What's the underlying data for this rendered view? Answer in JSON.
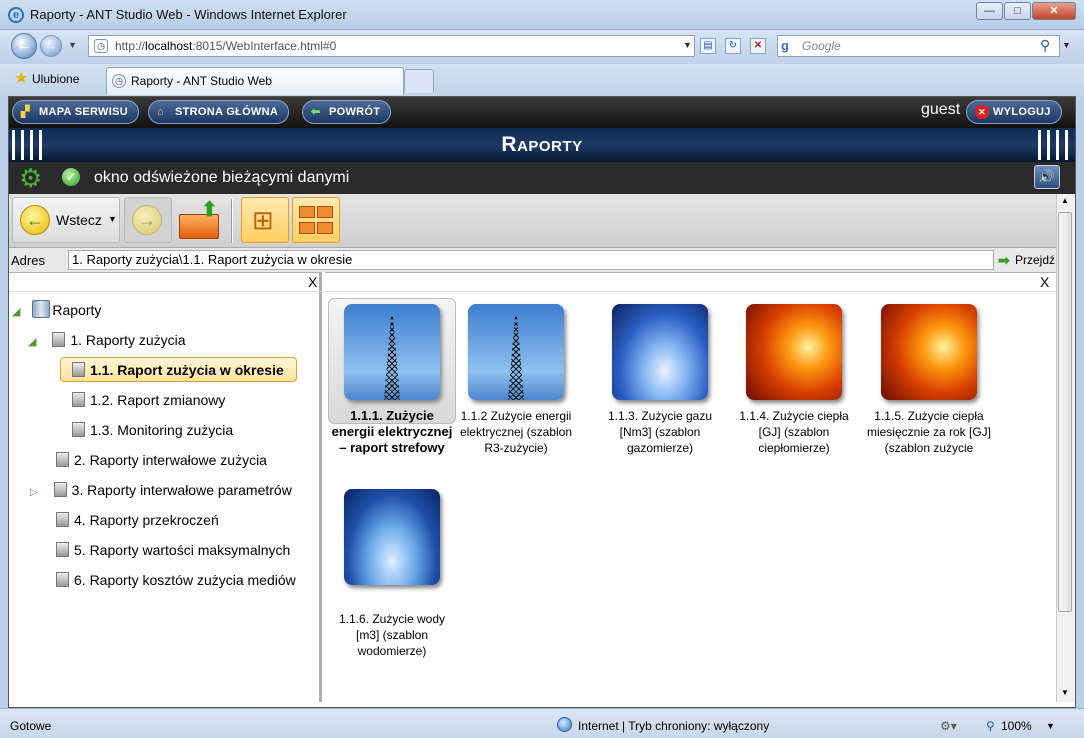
{
  "window": {
    "title": "Raporty - ANT Studio Web - Windows Internet Explorer",
    "url_prefix": "http://",
    "url_host": "localhost",
    "url_rest": ":8015/WebInterface.html#0",
    "search_placeholder": "Google",
    "favorites_label": "Ulubione",
    "tab_title": "Raporty - ANT Studio Web"
  },
  "app": {
    "nav_buttons": [
      "MAPA SERWISU",
      "STRONA GŁÓWNA",
      "POWRÓT"
    ],
    "user": "guest",
    "logout_label": "WYLOGUJ",
    "page_title": "Raporty",
    "status_message": "okno odświeżone bieżącymi danymi",
    "back_label": "Wstecz",
    "address_label": "Adres",
    "address_value": "1. Raporty zużycia\\1.1. Raport zużycia w okresie",
    "go_label": "Przejdź",
    "pane_close": "X"
  },
  "tree": {
    "root": "Raporty",
    "items": [
      "1. Raporty zużycia",
      "1.1. Raport zużycia w okresie",
      "1.2. Raport zmianowy",
      "1.3. Monitoring zużycia",
      "2. Raporty interwałowe zużycia",
      "3. Raporty interwałowe parametrów",
      "4. Raporty przekroczeń",
      "5. Raporty wartości maksymalnych",
      "6. Raporty kosztów zużycia mediów"
    ]
  },
  "tiles": [
    {
      "label": "1.1.1. Zużycie energii elektrycznej – raport strefowy",
      "icon": "power-pylon-image"
    },
    {
      "label": "1.1.2 Zużycie energii elektrycznej (szablon R3-zużycie)",
      "icon": "power-pylon-image"
    },
    {
      "label": "1.1.3. Zużycie gazu [Nm3] (szablon gazomierze)",
      "icon": "gas-flame-image"
    },
    {
      "label": "1.1.4. Zużycie ciepła [GJ] (szablon ciepłomierze)",
      "icon": "fire-image"
    },
    {
      "label": "1.1.5. Zużycie ciepła miesięcznie za rok [GJ] (szablon zużycie",
      "icon": "fire-image"
    },
    {
      "label": "1.1.6. Zużycie wody [m3] (szablon wodomierze)",
      "icon": "water-drop-image"
    }
  ],
  "ie_status": {
    "left": "Gotowe",
    "zone": "Internet | Tryb chroniony: wyłączony",
    "zoom": "100%"
  }
}
